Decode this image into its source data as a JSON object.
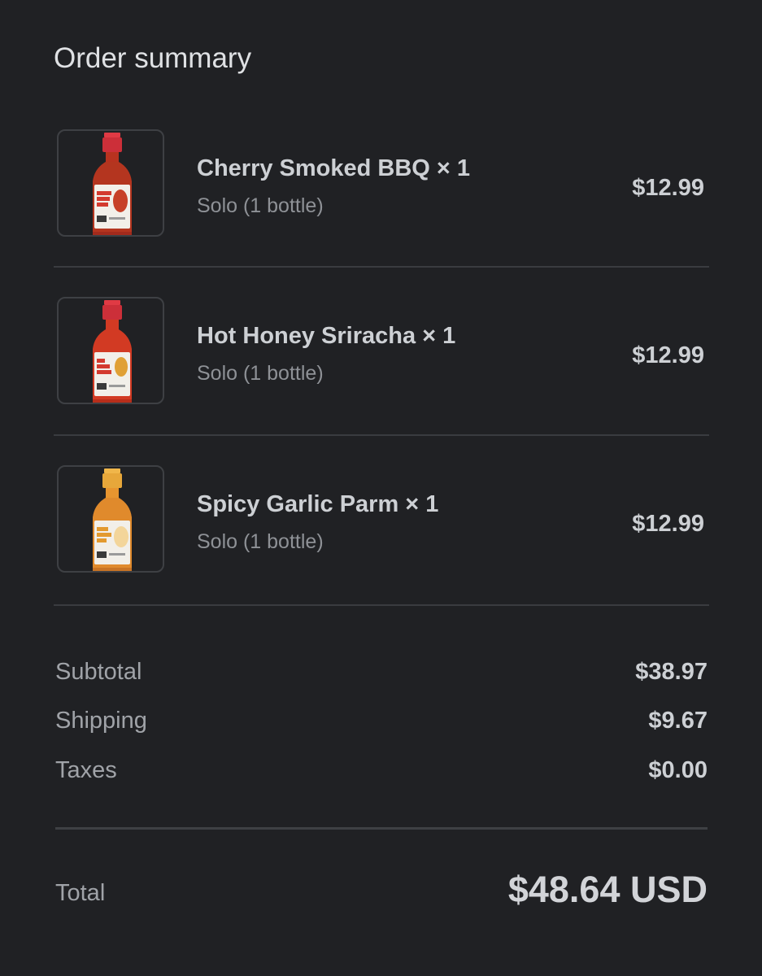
{
  "header": {
    "title": "Order summary"
  },
  "items": [
    {
      "name": "Cherry Smoked BBQ × 1",
      "variant": "Solo (1 bottle)",
      "price": "$12.99",
      "cap_color": "#d8303a",
      "sauce_color": "#b4351f",
      "label_text": "CHERRY SMOKED BBQ"
    },
    {
      "name": "Hot Honey Sriracha × 1",
      "variant": "Solo (1 bottle)",
      "price": "$12.99",
      "cap_color": "#d8303a",
      "sauce_color": "#d23a23",
      "label_text": "HOT HONEY SRIRACHA"
    },
    {
      "name": "Spicy Garlic Parm × 1",
      "variant": "Solo (1 bottle)",
      "price": "$12.99",
      "cap_color": "#e7a73a",
      "sauce_color": "#e08a2c",
      "label_text": "SPICY GARLIC PARM"
    }
  ],
  "summary": {
    "subtotal_label": "Subtotal",
    "subtotal_value": "$38.97",
    "shipping_label": "Shipping",
    "shipping_value": "$9.67",
    "taxes_label": "Taxes",
    "taxes_value": "$0.00"
  },
  "total": {
    "label": "Total",
    "value": "$48.64 USD"
  },
  "colors": {
    "background": "#202124",
    "text_primary": "#cdd0d4",
    "text_secondary": "#8e9196",
    "divider": "#3a3c40"
  }
}
